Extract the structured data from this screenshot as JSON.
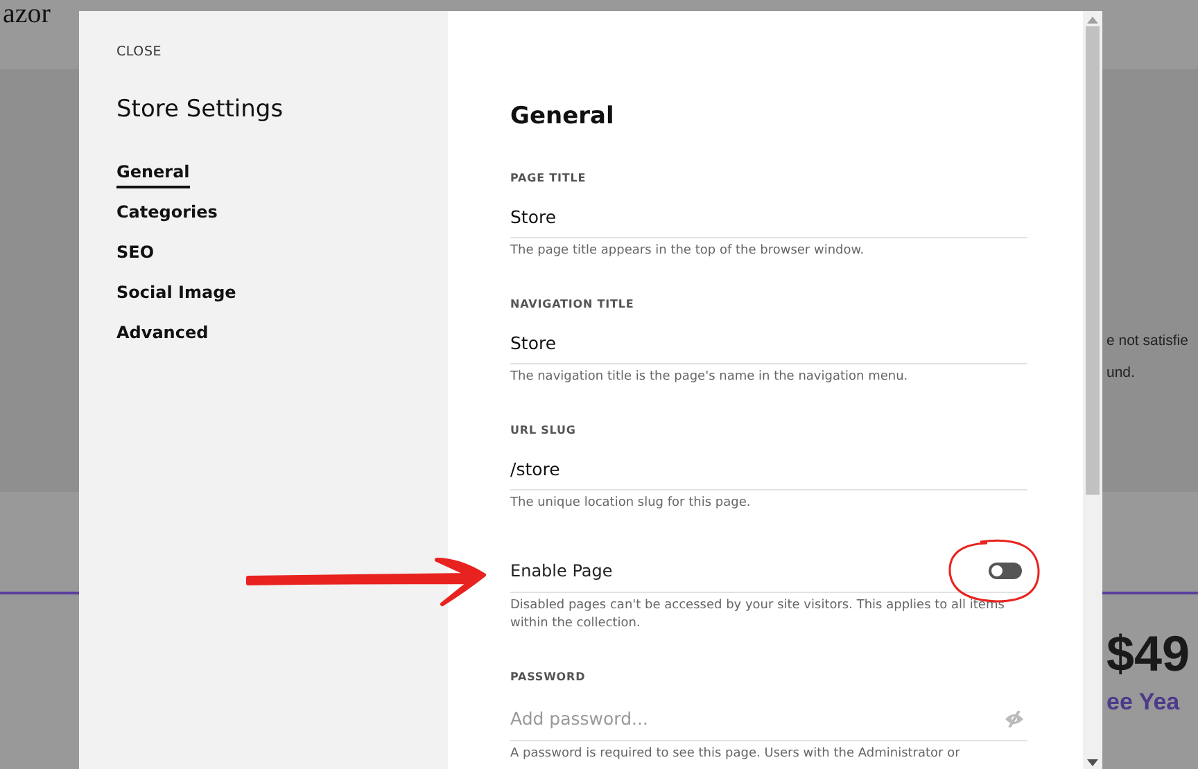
{
  "background": {
    "logo": [
      "azor"
    ],
    "texts": [
      "e not satisfie",
      "und."
    ],
    "price": "$49",
    "subtitle": "ee Yea"
  },
  "dialog": {
    "close": "CLOSE",
    "title": "Store Settings",
    "nav": [
      {
        "label": "General",
        "selected": true
      },
      {
        "label": "Categories",
        "selected": false
      },
      {
        "label": "SEO",
        "selected": false
      },
      {
        "label": "Social Image",
        "selected": false
      },
      {
        "label": "Advanced",
        "selected": false
      }
    ],
    "heading": "General",
    "fields": [
      {
        "kind": "text",
        "label": "PAGE TITLE",
        "value": "Store",
        "help": "The page title appears in the top of the browser window."
      },
      {
        "kind": "text",
        "label": "NAVIGATION TITLE",
        "value": "Store",
        "help": "The navigation title is the page's name in the navigation menu."
      },
      {
        "kind": "text",
        "label": "URL SLUG",
        "value": "/store",
        "help": "The unique location slug for this page."
      },
      {
        "kind": "toggle",
        "label": "Enable Page",
        "on": false,
        "help": "Disabled pages can't be accessed by your site visitors. This applies to all items within the collection."
      },
      {
        "kind": "password",
        "label": "PASSWORD",
        "placeholder": "Add password...",
        "help": "A password is required to see this page. Users with the Administrator or"
      }
    ]
  }
}
